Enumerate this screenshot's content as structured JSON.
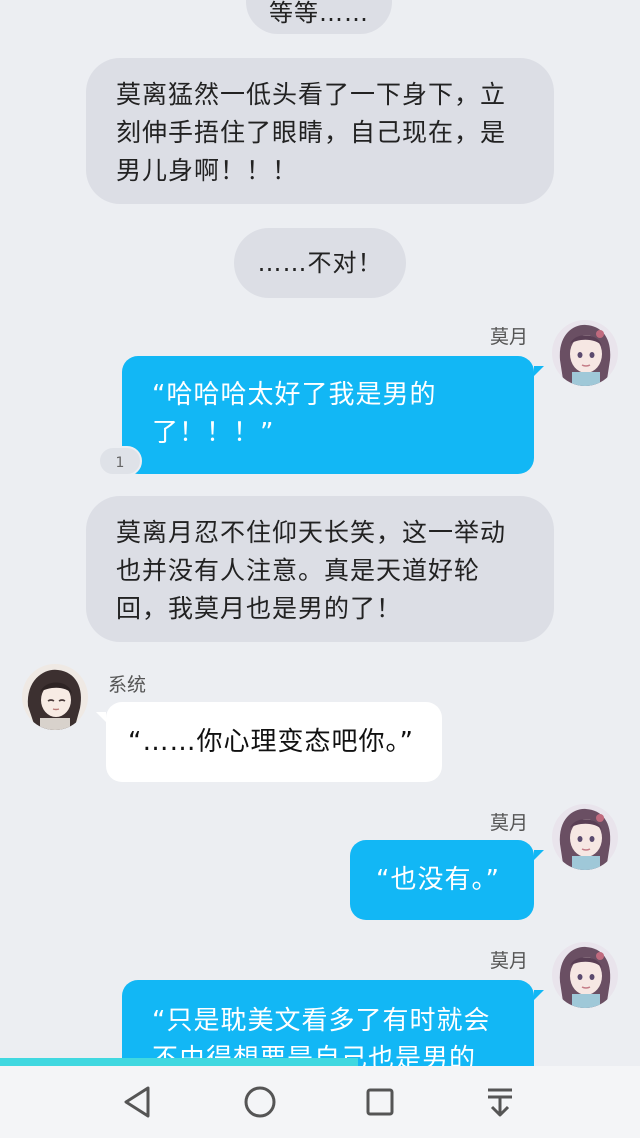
{
  "messages": {
    "narration_top_partial": "等等……",
    "narration_1": "莫离猛然一低头看了一下身下，立刻伸手捂住了眼睛，自己现在，是男儿身啊！！！",
    "narration_2": "……不对！",
    "msg_1": {
      "sender": "莫月",
      "text": "“哈哈哈太好了我是男的了！！！”",
      "badge": "1"
    },
    "narration_3": "莫离月忍不住仰天长笑，这一举动也并没有人注意。真是天道好轮回，我莫月也是男的了！",
    "msg_2": {
      "sender": "系统",
      "text": "“……你心理变态吧你。”"
    },
    "msg_3": {
      "sender": "莫月",
      "text": "“也没有。”"
    },
    "msg_4": {
      "sender": "莫月",
      "text": "“只是耽美文看多了有时就会不由得想要是自己也是男的"
    }
  },
  "navbar": {
    "back_icon": "back-triangle-icon",
    "home_icon": "home-circle-icon",
    "recents_icon": "recents-square-icon",
    "notifications_icon": "pull-down-icon"
  },
  "colors": {
    "background": "#eceef2",
    "narration_bubble": "#dcdee5",
    "sent_bubble": "#12b7f5",
    "received_bubble": "#ffffff",
    "progress": "#40d8e0"
  }
}
